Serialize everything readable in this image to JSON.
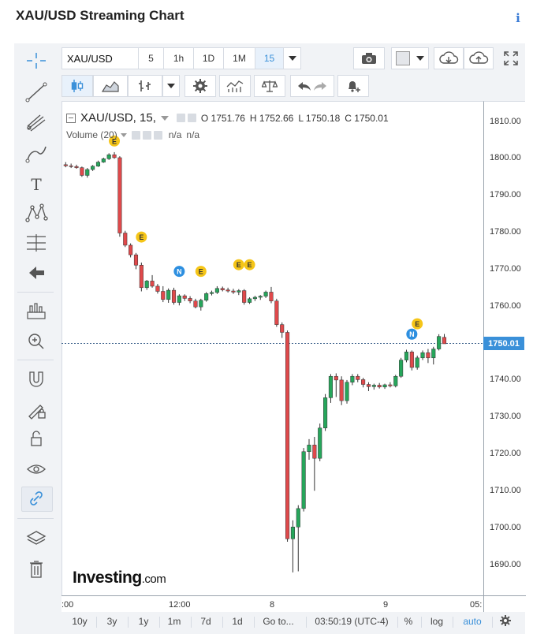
{
  "header": {
    "title": "XAU/USD Streaming Chart",
    "info_icon": "info-icon"
  },
  "topbar": {
    "symbol": "XAU/USD",
    "intervals": [
      "5",
      "1h",
      "1D",
      "1M",
      "15"
    ],
    "selected_interval": "15"
  },
  "legend": {
    "symbol_line": "XAU/USD, 15,",
    "open": "O 1751.76",
    "high": "H 1752.66",
    "low": "L 1750.18",
    "close": "C 1750.01",
    "volume_label": "Volume (20)",
    "volume_v1": "n/a",
    "volume_v2": "n/a"
  },
  "price_axis": {
    "ticks": [
      "1810.00",
      "1800.00",
      "1790.00",
      "1780.00",
      "1770.00",
      "1760.00",
      "1750.01",
      "1740.00",
      "1730.00",
      "1720.00",
      "1710.00",
      "1700.00",
      "1690.00"
    ],
    "last_price": "1750.01"
  },
  "time_axis": {
    "labels": [
      ":00",
      "12:00",
      "8",
      "9",
      "05:"
    ]
  },
  "brand": {
    "name": "Investing",
    "suffix": ".com"
  },
  "events": {
    "e": "E",
    "n": "N"
  },
  "bottombar": {
    "ranges": [
      "10y",
      "3y",
      "1y",
      "1m",
      "7d",
      "1d"
    ],
    "goto": "Go to...",
    "clock": "03:50:19 (UTC-4)",
    "pct": "%",
    "log": "log",
    "auto": "auto"
  },
  "colors": {
    "up": "#26a65b",
    "down": "#e0494b",
    "accent": "#3a90d9"
  },
  "chart_data": {
    "type": "candlestick",
    "ylim": [
      1685,
      1815
    ],
    "candles": [
      [
        1798.5,
        1799.2,
        1797.8,
        1798.2
      ],
      [
        1798.2,
        1798.8,
        1797.6,
        1798.0
      ],
      [
        1798.0,
        1798.5,
        1797.4,
        1797.7
      ],
      [
        1797.7,
        1798.0,
        1795.2,
        1795.6
      ],
      [
        1795.6,
        1797.6,
        1795.0,
        1797.2
      ],
      [
        1797.2,
        1798.4,
        1796.8,
        1798.1
      ],
      [
        1798.1,
        1799.6,
        1797.9,
        1799.2
      ],
      [
        1799.2,
        1800.4,
        1799.0,
        1800.1
      ],
      [
        1800.1,
        1801.6,
        1799.8,
        1801.2
      ],
      [
        1801.2,
        1801.9,
        1800.1,
        1800.4
      ],
      [
        1800.4,
        1800.8,
        1779.0,
        1780.0
      ],
      [
        1780.0,
        1780.6,
        1776.2,
        1776.7
      ],
      [
        1776.7,
        1777.2,
        1773.4,
        1774.1
      ],
      [
        1774.1,
        1774.6,
        1770.2,
        1771.3
      ],
      [
        1771.3,
        1772.0,
        1764.2,
        1765.2
      ],
      [
        1765.2,
        1767.3,
        1764.6,
        1767.0
      ],
      [
        1767.0,
        1768.6,
        1765.2,
        1765.6
      ],
      [
        1765.6,
        1766.2,
        1763.6,
        1764.2
      ],
      [
        1764.2,
        1765.6,
        1761.3,
        1762.0
      ],
      [
        1762.0,
        1765.0,
        1761.1,
        1764.5
      ],
      [
        1764.5,
        1765.2,
        1760.6,
        1761.2
      ],
      [
        1761.2,
        1763.4,
        1760.4,
        1763.0
      ],
      [
        1763.0,
        1763.4,
        1761.6,
        1762.3
      ],
      [
        1762.3,
        1762.9,
        1761.0,
        1761.6
      ],
      [
        1761.6,
        1762.2,
        1759.6,
        1760.0
      ],
      [
        1760.0,
        1762.2,
        1759.0,
        1761.8
      ],
      [
        1761.8,
        1764.0,
        1761.4,
        1763.6
      ],
      [
        1763.6,
        1764.4,
        1763.1,
        1763.9
      ],
      [
        1763.9,
        1765.6,
        1763.5,
        1765.0
      ],
      [
        1765.0,
        1765.5,
        1764.2,
        1764.6
      ],
      [
        1764.6,
        1765.2,
        1763.9,
        1764.3
      ],
      [
        1764.3,
        1764.9,
        1763.5,
        1764.0
      ],
      [
        1764.0,
        1764.8,
        1763.2,
        1764.4
      ],
      [
        1764.4,
        1764.8,
        1760.6,
        1761.2
      ],
      [
        1761.2,
        1762.6,
        1760.8,
        1762.2
      ],
      [
        1762.2,
        1763.0,
        1761.6,
        1762.6
      ],
      [
        1762.6,
        1763.2,
        1761.9,
        1762.9
      ],
      [
        1762.9,
        1764.4,
        1762.4,
        1764.0
      ],
      [
        1764.0,
        1765.4,
        1761.0,
        1761.6
      ],
      [
        1761.6,
        1762.2,
        1754.6,
        1755.2
      ],
      [
        1755.2,
        1755.8,
        1751.6,
        1753.1
      ],
      [
        1753.1,
        1753.6,
        1696.4,
        1697.2
      ],
      [
        1697.2,
        1702.2,
        1688.1,
        1700.4
      ],
      [
        1700.4,
        1706.3,
        1688.4,
        1705.4
      ],
      [
        1705.4,
        1721.8,
        1704.6,
        1720.8
      ],
      [
        1720.8,
        1724.2,
        1718.6,
        1722.6
      ],
      [
        1722.6,
        1724.8,
        1710.2,
        1719.0
      ],
      [
        1719.0,
        1728.4,
        1718.2,
        1727.2
      ],
      [
        1727.2,
        1736.4,
        1726.4,
        1735.4
      ],
      [
        1735.4,
        1741.8,
        1734.0,
        1741.2
      ],
      [
        1741.2,
        1742.0,
        1735.6,
        1740.2
      ],
      [
        1740.2,
        1741.2,
        1733.4,
        1734.6
      ],
      [
        1734.6,
        1740.2,
        1733.8,
        1739.6
      ],
      [
        1739.6,
        1741.8,
        1738.8,
        1741.2
      ],
      [
        1741.2,
        1741.8,
        1739.6,
        1740.3
      ],
      [
        1740.3,
        1740.8,
        1738.2,
        1739.0
      ],
      [
        1739.0,
        1739.6,
        1737.2,
        1738.4
      ],
      [
        1738.4,
        1739.2,
        1737.6,
        1738.8
      ],
      [
        1738.8,
        1739.4,
        1737.9,
        1738.3
      ],
      [
        1738.3,
        1739.2,
        1737.8,
        1738.9
      ],
      [
        1738.9,
        1739.6,
        1738.2,
        1738.6
      ],
      [
        1738.6,
        1741.6,
        1738.2,
        1741.2
      ],
      [
        1741.2,
        1746.2,
        1740.8,
        1745.6
      ],
      [
        1745.6,
        1748.4,
        1745.0,
        1747.8
      ],
      [
        1747.8,
        1748.2,
        1742.8,
        1743.6
      ],
      [
        1743.6,
        1746.8,
        1743.0,
        1746.2
      ],
      [
        1746.2,
        1748.2,
        1745.6,
        1747.6
      ],
      [
        1747.6,
        1748.6,
        1744.8,
        1746.2
      ],
      [
        1746.2,
        1749.2,
        1744.4,
        1748.6
      ],
      [
        1748.6,
        1752.6,
        1748.2,
        1752.0
      ],
      [
        1751.76,
        1752.66,
        1750.18,
        1750.01
      ]
    ]
  }
}
